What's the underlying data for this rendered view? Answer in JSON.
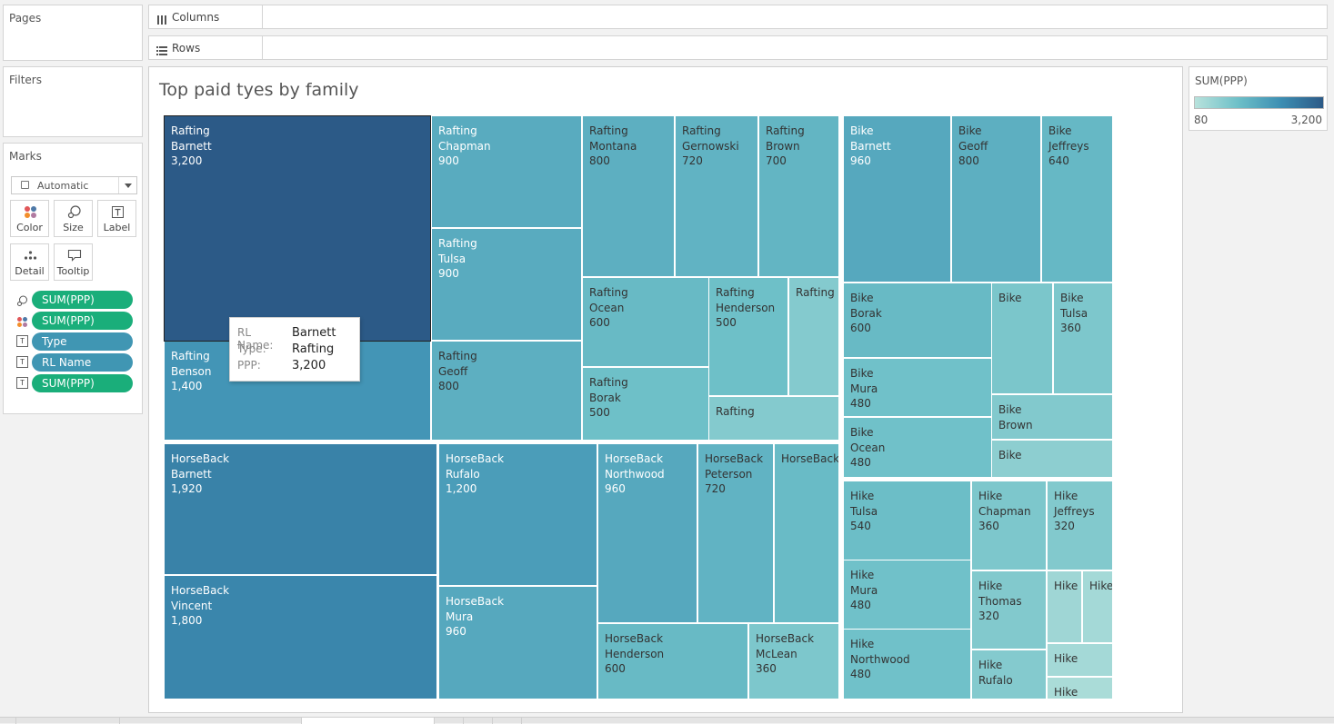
{
  "cards": {
    "pages": "Pages",
    "filters": "Filters",
    "marks": "Marks"
  },
  "marks": {
    "mark_type": "Automatic",
    "buttons": [
      {
        "name": "color",
        "label": "Color",
        "icon": "color-dots-icon"
      },
      {
        "name": "size",
        "label": "Size",
        "icon": "size-bubble-icon"
      },
      {
        "name": "label",
        "label": "Label",
        "icon": "text-label-icon"
      },
      {
        "name": "detail",
        "label": "Detail",
        "icon": "detail-dots-icon"
      },
      {
        "name": "tooltip",
        "label": "Tooltip",
        "icon": "speech-bubble-icon"
      }
    ],
    "pills": [
      {
        "icon": "size-bubble-icon",
        "label": "SUM(PPP)",
        "color": "green"
      },
      {
        "icon": "color-dots-icon",
        "label": "SUM(PPP)",
        "color": "green"
      },
      {
        "icon": "text-label-icon",
        "label": "Type",
        "color": "blue"
      },
      {
        "icon": "text-label-icon",
        "label": "RL Name",
        "color": "blue"
      },
      {
        "icon": "text-label-icon",
        "label": "SUM(PPP)",
        "color": "green"
      }
    ]
  },
  "shelves": {
    "columns": "Columns",
    "rows": "Rows"
  },
  "sheet": {
    "title": "Top paid tyes by family"
  },
  "legend": {
    "title": "SUM(PPP)",
    "min": "80",
    "max": "3,200"
  },
  "tooltip": {
    "rows": [
      {
        "key": "RL Name:",
        "value": "Barnett"
      },
      {
        "key": "Type:",
        "value": "Rafting"
      },
      {
        "key": "PPP:",
        "value": "3,200"
      }
    ]
  },
  "chart_data": {
    "type": "treemap",
    "title": "Top paid tyes by family",
    "color_measure": "SUM(PPP)",
    "color_range": [
      80,
      3200
    ],
    "colors": {
      "low": "#b8e2dc",
      "mid": "#6ec0c8",
      "high": "#3d8fb3",
      "max": "#2c5a87"
    },
    "cells": [
      {
        "type": "Rafting",
        "name": "Barnett",
        "label": "3,200",
        "value": 3200
      },
      {
        "type": "Rafting",
        "name": "Benson",
        "label": "1,400",
        "value": 1400
      },
      {
        "type": "Rafting",
        "name": "Chapman",
        "label": "900",
        "value": 900
      },
      {
        "type": "Rafting",
        "name": "Tulsa",
        "label": "900",
        "value": 900
      },
      {
        "type": "Rafting",
        "name": "Geoff",
        "label": "800",
        "value": 800
      },
      {
        "type": "Rafting",
        "name": "Montana",
        "label": "800",
        "value": 800
      },
      {
        "type": "Rafting",
        "name": "Gernowski",
        "label": "720",
        "value": 720
      },
      {
        "type": "Rafting",
        "name": "Brown",
        "label": "700",
        "value": 700
      },
      {
        "type": "Rafting",
        "name": "Ocean",
        "label": "600",
        "value": 600
      },
      {
        "type": "Rafting",
        "name": "Henderson",
        "label": "500",
        "value": 500
      },
      {
        "type": "Rafting",
        "name": "Borak",
        "label": "500",
        "value": 500
      },
      {
        "type": "Rafting",
        "name": "",
        "label": "",
        "value": 300
      },
      {
        "type": "Rafting",
        "name": "",
        "label": "",
        "value": 300
      },
      {
        "type": "Bike",
        "name": "Barnett",
        "label": "960",
        "value": 960
      },
      {
        "type": "Bike",
        "name": "Geoff",
        "label": "800",
        "value": 800
      },
      {
        "type": "Bike",
        "name": "Jeffreys",
        "label": "640",
        "value": 640
      },
      {
        "type": "Bike",
        "name": "Borak",
        "label": "600",
        "value": 600
      },
      {
        "type": "Bike",
        "name": "",
        "label": "",
        "value": 380
      },
      {
        "type": "Bike",
        "name": "Tulsa",
        "label": "360",
        "value": 360
      },
      {
        "type": "Bike",
        "name": "Mura",
        "label": "480",
        "value": 480
      },
      {
        "type": "Bike",
        "name": "Brown",
        "label": "",
        "value": 320
      },
      {
        "type": "Bike",
        "name": "Ocean",
        "label": "480",
        "value": 480
      },
      {
        "type": "Bike",
        "name": "",
        "label": "",
        "value": 240
      },
      {
        "type": "HorseBack",
        "name": "Barnett",
        "label": "1,920",
        "value": 1920
      },
      {
        "type": "HorseBack",
        "name": "Vincent",
        "label": "1,800",
        "value": 1800
      },
      {
        "type": "HorseBack",
        "name": "Rufalo",
        "label": "1,200",
        "value": 1200
      },
      {
        "type": "HorseBack",
        "name": "Mura",
        "label": "960",
        "value": 960
      },
      {
        "type": "HorseBack",
        "name": "Northwood",
        "label": "960",
        "value": 960
      },
      {
        "type": "HorseBack",
        "name": "Peterson",
        "label": "720",
        "value": 720
      },
      {
        "type": "HorseBack",
        "name": "",
        "label": "",
        "value": 580
      },
      {
        "type": "HorseBack",
        "name": "Henderson",
        "label": "600",
        "value": 600
      },
      {
        "type": "HorseBack",
        "name": "McLean",
        "label": "360",
        "value": 360
      },
      {
        "type": "Hike",
        "name": "Tulsa",
        "label": "540",
        "value": 540
      },
      {
        "type": "Hike",
        "name": "Mura",
        "label": "480",
        "value": 480
      },
      {
        "type": "Hike",
        "name": "Northwood",
        "label": "480",
        "value": 480
      },
      {
        "type": "Hike",
        "name": "Chapman",
        "label": "360",
        "value": 360
      },
      {
        "type": "Hike",
        "name": "Jeffreys",
        "label": "320",
        "value": 320
      },
      {
        "type": "Hike",
        "name": "Thomas",
        "label": "320",
        "value": 320
      },
      {
        "type": "Hike",
        "name": "Rufalo",
        "label": "",
        "value": 300
      },
      {
        "type": "Hike",
        "name": "",
        "label": "",
        "value": 140
      },
      {
        "type": "Hike",
        "name": "",
        "label": "",
        "value": 120
      },
      {
        "type": "Hike",
        "name": "",
        "label": "",
        "value": 120
      },
      {
        "type": "Hike",
        "name": "",
        "label": "",
        "value": 100
      }
    ]
  }
}
